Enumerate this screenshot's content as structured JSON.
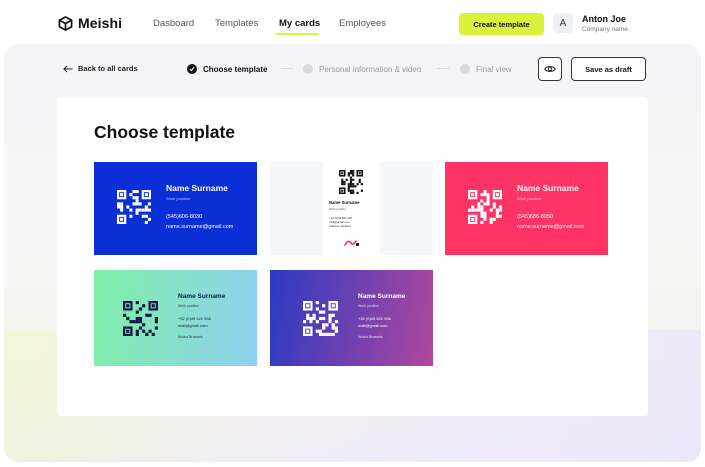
{
  "app": {
    "brand": "Meishi"
  },
  "nav": {
    "links": [
      "Dasboard",
      "Templates",
      "My cards",
      "Employees"
    ],
    "active": "My cards"
  },
  "header": {
    "create_label": "Create template",
    "avatar_initial": "A",
    "user_name": "Anton Joe",
    "company": "Company name"
  },
  "steps": {
    "back_label": "Back to all cards",
    "items": [
      "Choose template",
      "Personal information & video",
      "Final view"
    ],
    "current": 0
  },
  "toolbar": {
    "draft_label": "Save as draft"
  },
  "main": {
    "title": "Choose template"
  },
  "templates": [
    {
      "name": "Name Surname",
      "position": "Work position",
      "phone": "(545)606-8030",
      "email": "name.surname@gmail.com",
      "background": "#0a2fd6",
      "text_color": "#ffffff"
    },
    {
      "name": "Name Surname",
      "position": "Work position",
      "phone": "+32 (0)49 521 936",
      "email": "mail@gmail.com",
      "address": "Address, Address",
      "logo": "Logo",
      "background": "#ffffff",
      "text_color": "#111111"
    },
    {
      "name": "Name Surname",
      "position": "Work position",
      "phone": "(545)686-8050",
      "email": "name.surname@gmail.com",
      "background": "#ff3366",
      "text_color": "#ffffff"
    },
    {
      "name": "Name Surname",
      "position": "Work position",
      "phone": "+32 (0)49 521 936",
      "email": "mail@gmail.com",
      "address": "Nodus Brussels",
      "background_from": "#7ff0a6",
      "background_to": "#8fd0f2",
      "text_color": "#0d1b3d"
    },
    {
      "name": "Name Surname",
      "position": "Work position",
      "phone": "+32 (0)49 521 936",
      "email": "mail@gmail.com",
      "address": "Nodus Brussels",
      "background_from": "#2a3ac4",
      "background_to": "#b0479c",
      "text_color": "#ffffff"
    }
  ],
  "colors": {
    "accent": "#dcf23a",
    "text": "#111111",
    "muted": "#999999"
  }
}
